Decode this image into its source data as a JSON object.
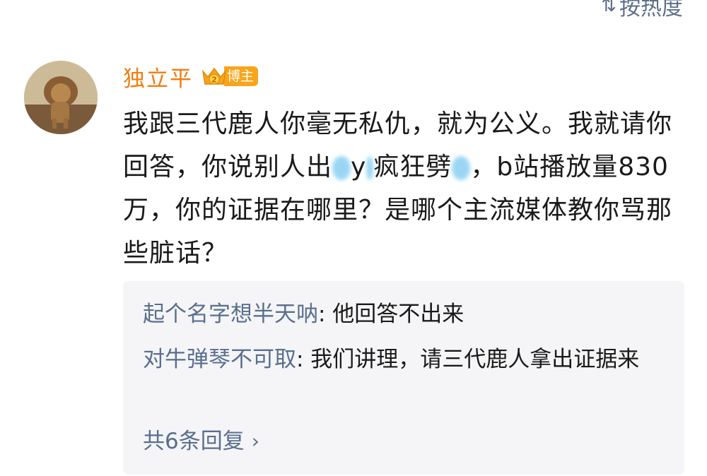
{
  "sort": {
    "icon": "sort-icon",
    "label": "按热度"
  },
  "comment": {
    "username": "独立平",
    "badge_label": "博主",
    "badge_level": "2",
    "text_part1": "我跟三代鹿人你毫无私仇，就为公义。我就请你回答，你说别人出",
    "text_part2": "y",
    "text_part3": "疯狂劈",
    "text_part4": "，b站播放量830万，你的证据在哪里？是哪个主流媒体教你骂那些脏话？"
  },
  "replies": [
    {
      "author": "起个名字想半天呐",
      "text": ": 他回答不出来"
    },
    {
      "author": "对牛弹琴不可取",
      "text": ": 我们讲理，请三代鹿人拿出证据来"
    }
  ],
  "more_replies_label": "共6条回复",
  "colors": {
    "username": "#f07d12",
    "link": "#5a6f8e",
    "badge": "#f8a51b",
    "reply_bg": "#f5f5f7"
  }
}
